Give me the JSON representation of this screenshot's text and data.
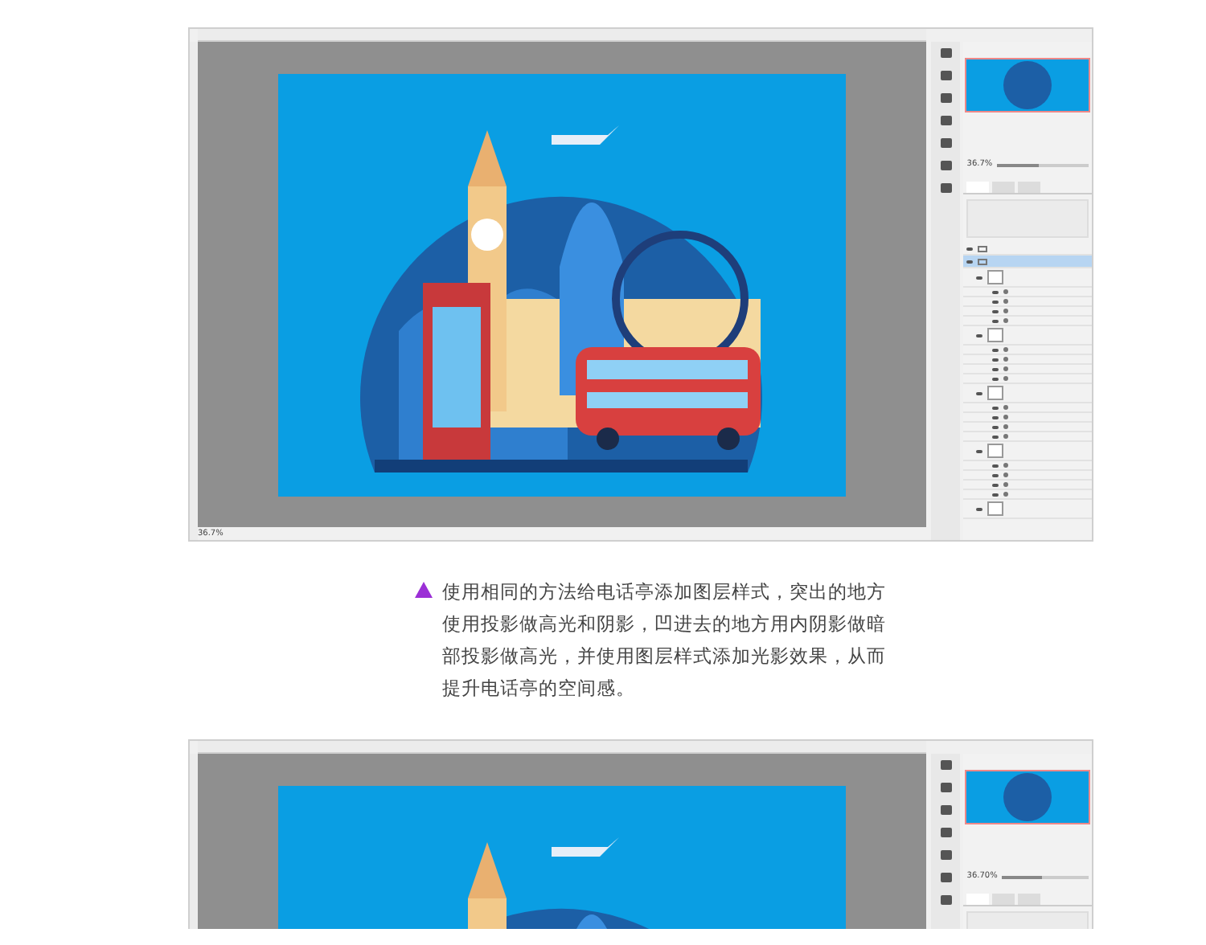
{
  "screenshots": [
    {
      "zoom": "36.7%",
      "navigator": {
        "zoom": "36.7%",
        "level": 0.45
      },
      "panel_tabs": [
        {
          "selected": true
        },
        {
          "selected": false
        },
        {
          "selected": false
        }
      ],
      "layers": [
        {
          "kind": "group",
          "selected": false
        },
        {
          "kind": "group",
          "selected": true,
          "children": [
            {
              "kind": "layer",
              "selected": false,
              "children": [
                {
                  "kind": "effect",
                  "selected": false
                },
                {
                  "kind": "effect",
                  "selected": false
                },
                {
                  "kind": "effect",
                  "selected": false
                },
                {
                  "kind": "effect",
                  "selected": false
                }
              ]
            },
            {
              "kind": "layer",
              "selected": false,
              "children": [
                {
                  "kind": "effect",
                  "selected": false
                },
                {
                  "kind": "effect",
                  "selected": false
                },
                {
                  "kind": "effect",
                  "selected": false
                },
                {
                  "kind": "effect",
                  "selected": false
                }
              ]
            },
            {
              "kind": "layer",
              "selected": false,
              "children": [
                {
                  "kind": "effect",
                  "selected": false
                },
                {
                  "kind": "effect",
                  "selected": false
                },
                {
                  "kind": "effect",
                  "selected": false
                },
                {
                  "kind": "effect",
                  "selected": false
                }
              ]
            },
            {
              "kind": "layer",
              "selected": false,
              "children": [
                {
                  "kind": "effect",
                  "selected": false
                },
                {
                  "kind": "effect",
                  "selected": false
                },
                {
                  "kind": "effect",
                  "selected": false
                },
                {
                  "kind": "effect",
                  "selected": false
                }
              ]
            },
            {
              "kind": "layer",
              "selected": false
            }
          ]
        }
      ]
    },
    {
      "navigator": {
        "zoom": "36.70%",
        "level": 0.45
      },
      "panel_tabs": [
        {
          "selected": true
        },
        {
          "selected": false
        },
        {
          "selected": false
        }
      ]
    }
  ],
  "caption": {
    "text": "使用相同的方法给电话亭添加图层样式，突出的地方使用投影做高光和阴影，凹进去的地方用内阴影做暗部投影做高光，并使用图层样式添加光影效果，从而提升电话亭的空间感。"
  }
}
